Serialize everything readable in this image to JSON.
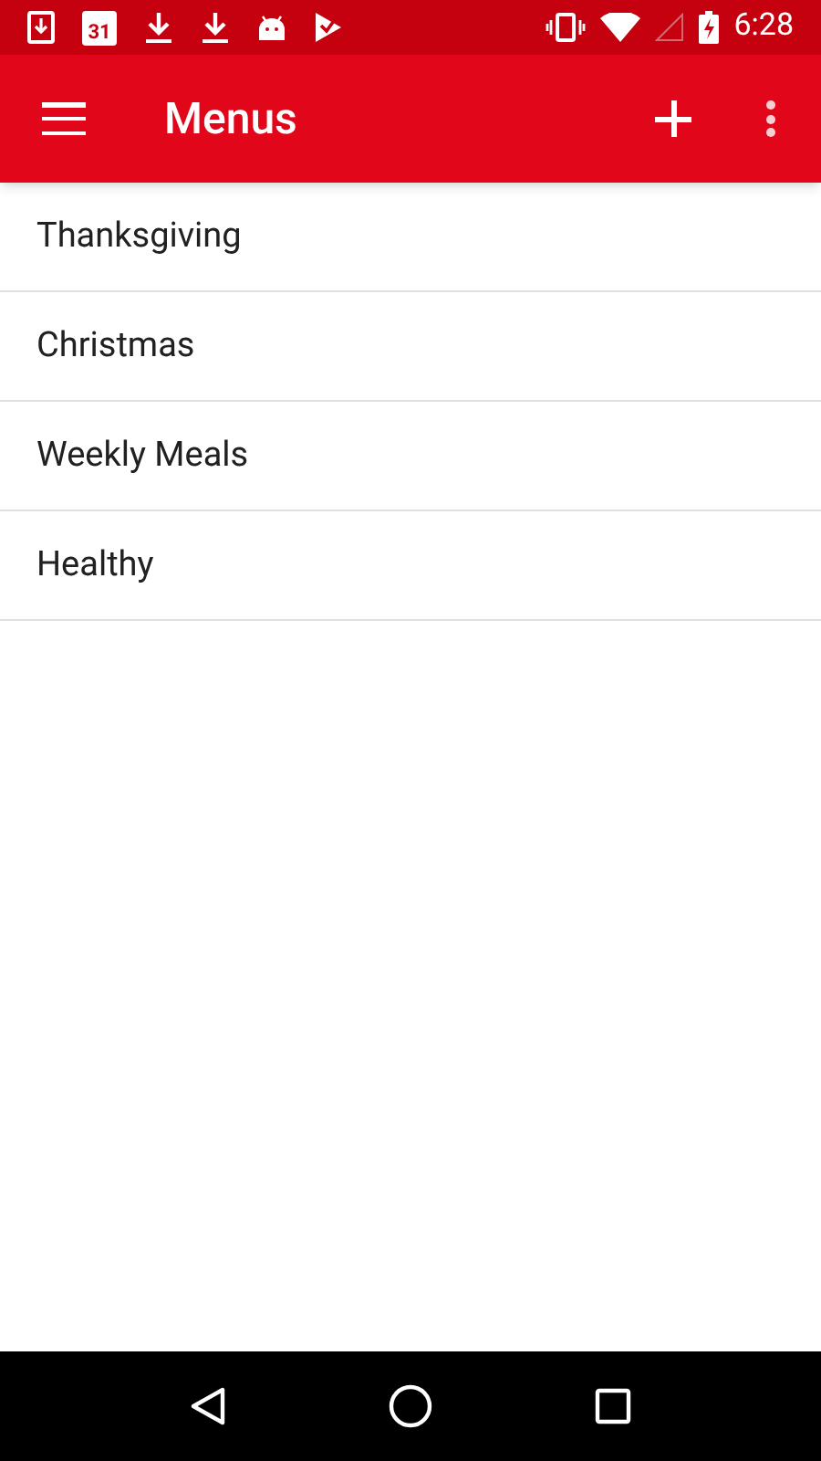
{
  "status_bar": {
    "calendar_day": "31",
    "time": "6:28"
  },
  "app_bar": {
    "title": "Menus"
  },
  "menus": [
    {
      "label": "Thanksgiving"
    },
    {
      "label": "Christmas"
    },
    {
      "label": "Weekly Meals"
    },
    {
      "label": "Healthy"
    }
  ]
}
